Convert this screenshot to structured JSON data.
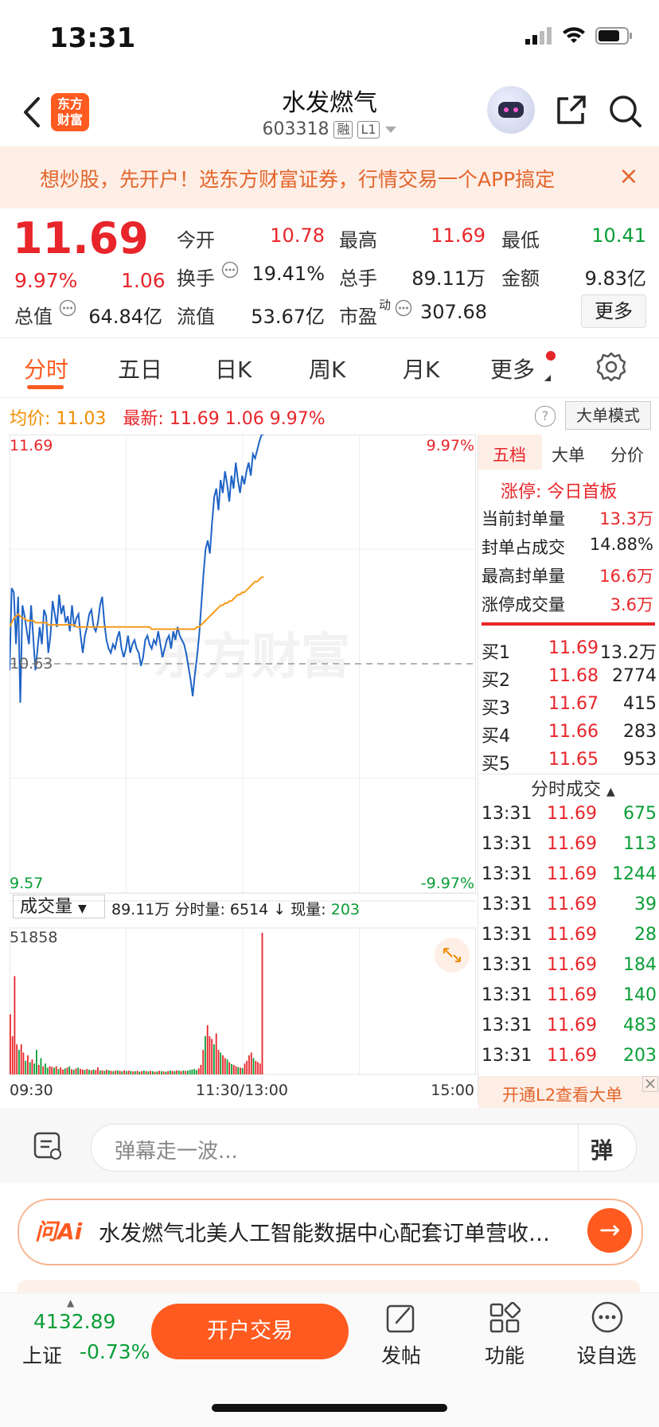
{
  "status_bar": {
    "time": "13:31"
  },
  "header": {
    "back_icon": "chevron-left-icon",
    "logo_line1": "东方",
    "logo_line2": "财富",
    "stock_name": "水发燃气",
    "stock_code": "603318",
    "tag_margin": "融",
    "tag_level": "L1"
  },
  "banner": {
    "text": "想炒股，先开户！选东方财富证券，行情交易一个APP搞定",
    "close": "×"
  },
  "quote": {
    "price": "11.69",
    "change_pct": "9.97%",
    "change": "1.06",
    "fields": [
      {
        "label": "今开",
        "value": "10.78",
        "color": "red"
      },
      {
        "label": "最高",
        "value": "11.69",
        "color": "red"
      },
      {
        "label": "最低",
        "value": "10.41",
        "color": "green"
      },
      {
        "label": "换手",
        "value": "19.41%",
        "color": "black"
      },
      {
        "label": "总手",
        "value": "89.11万",
        "color": "black"
      },
      {
        "label": "金额",
        "value": "9.83亿",
        "color": "black"
      },
      {
        "label": "总值",
        "value": "64.84亿",
        "color": "black"
      },
      {
        "label": "流值",
        "value": "53.67亿",
        "color": "black"
      },
      {
        "label": "市盈",
        "value": "307.68",
        "color": "black"
      }
    ],
    "pe_superscript": "动",
    "more_label": "更多"
  },
  "tabs": [
    "分时",
    "五日",
    "日K",
    "周K",
    "月K",
    "更多"
  ],
  "info_row": {
    "avg_label": "均价:",
    "avg_value": "11.03",
    "latest_label": "最新:",
    "latest_price": "11.69",
    "latest_change": "1.06",
    "latest_pct": "9.97%",
    "help": "?",
    "big_order_mode": "大单模式"
  },
  "chart": {
    "price_top": "11.69",
    "price_mid": "10.63",
    "price_bottom": "9.57",
    "pct_top": "9.97%",
    "pct_bottom": "-9.97%",
    "watermark": "东方财富",
    "vol_max_label": "51858",
    "time_start": "09:30",
    "time_mid": "11:30/13:00",
    "time_end": "15:00"
  },
  "chart_data": {
    "type": "line",
    "xlabel": "",
    "ylabel": "",
    "ylim": [
      9.57,
      11.69
    ],
    "x_ticks": [
      "09:30",
      "11:30/13:00",
      "15:00"
    ],
    "prev_close": 10.63,
    "series": [
      {
        "values": [
          10.6,
          10.98,
          10.96,
          10.72,
          10.94,
          10.45,
          10.9,
          10.85,
          10.78,
          10.72,
          10.9,
          10.75,
          10.6,
          10.7,
          10.8,
          10.72,
          10.88,
          10.85,
          10.68,
          10.76,
          10.92,
          10.86,
          10.8,
          10.95,
          10.86,
          10.9,
          10.82,
          10.85,
          10.78,
          10.9,
          10.8,
          10.84,
          10.86,
          10.76,
          10.68,
          10.76,
          10.8,
          10.86,
          10.88,
          10.8,
          10.78,
          10.82,
          10.9,
          10.94,
          10.82,
          10.74,
          10.7,
          10.68,
          10.72,
          10.7,
          10.75,
          10.78,
          10.7,
          10.66,
          10.7,
          10.76,
          10.68,
          10.72,
          10.74,
          10.7,
          10.68,
          10.62,
          10.66,
          10.74,
          10.76,
          10.72,
          10.7,
          10.74,
          10.72,
          10.78,
          10.72,
          10.66,
          10.7,
          10.74,
          10.76,
          10.7,
          10.78,
          10.74,
          10.8,
          10.76,
          10.74,
          10.72,
          10.68,
          10.62,
          10.56,
          10.48,
          10.58,
          10.66,
          10.76,
          10.9,
          11.04,
          11.16,
          11.2,
          11.14,
          11.28,
          11.4,
          11.44,
          11.34,
          11.48,
          11.42,
          11.52,
          11.46,
          11.38,
          11.5,
          11.44,
          11.56,
          11.48,
          11.42,
          11.5,
          11.46,
          11.52,
          11.56,
          11.5,
          11.6,
          11.58,
          11.62,
          11.66,
          11.69,
          11.69
        ]
      },
      {
        "values": [
          10.8,
          10.82,
          10.84,
          10.85,
          10.86,
          10.85,
          10.84,
          10.84,
          10.83,
          10.83,
          10.83,
          10.83,
          10.82,
          10.82,
          10.82,
          10.82,
          10.82,
          10.82,
          10.81,
          10.81,
          10.81,
          10.81,
          10.81,
          10.81,
          10.81,
          10.81,
          10.81,
          10.81,
          10.81,
          10.81,
          10.81,
          10.8,
          10.8,
          10.8,
          10.8,
          10.8,
          10.8,
          10.8,
          10.8,
          10.8,
          10.8,
          10.8,
          10.8,
          10.8,
          10.8,
          10.8,
          10.8,
          10.8,
          10.8,
          10.8,
          10.8,
          10.8,
          10.8,
          10.8,
          10.8,
          10.8,
          10.8,
          10.8,
          10.8,
          10.8,
          10.8,
          10.8,
          10.8,
          10.8,
          10.8,
          10.8,
          10.79,
          10.79,
          10.79,
          10.79,
          10.79,
          10.79,
          10.79,
          10.79,
          10.79,
          10.79,
          10.79,
          10.79,
          10.79,
          10.79,
          10.79,
          10.79,
          10.79,
          10.79,
          10.79,
          10.79,
          10.79,
          10.8,
          10.8,
          10.81,
          10.82,
          10.83,
          10.84,
          10.85,
          10.86,
          10.87,
          10.88,
          10.89,
          10.9,
          10.9,
          10.91,
          10.91,
          10.92,
          10.92,
          10.93,
          10.94,
          10.95,
          10.95,
          10.96,
          10.96,
          10.97,
          10.98,
          10.99,
          11.0,
          11.01,
          11.01,
          11.02,
          11.03,
          11.03
        ]
      }
    ],
    "volume": {
      "ymax": 51858,
      "values": [
        22000,
        14000,
        36000,
        11000,
        9000,
        11000,
        8000,
        5000,
        7000,
        4500,
        5500,
        4000,
        9000,
        3500,
        6000,
        3000,
        4000,
        2500,
        3000,
        2800,
        2500,
        3000,
        2000,
        2600,
        1800,
        2200,
        2500,
        3000,
        1900,
        1700,
        2200,
        2500,
        2000,
        1800,
        1600,
        2000,
        1700,
        1500,
        1800,
        1600,
        2600,
        1400,
        1500,
        1300,
        1700,
        1500,
        1300,
        1200,
        1400,
        1500,
        1300,
        1100,
        1500,
        1200,
        1400,
        1300,
        1100,
        1200,
        1300,
        1000,
        1200,
        1400,
        1200,
        1100,
        1300,
        1200,
        1000,
        1100,
        1300,
        1200,
        1100,
        1000,
        1200,
        1400,
        1300,
        1200,
        1500,
        1400,
        1200,
        1500,
        1300,
        1400,
        1600,
        1800,
        2000,
        1600,
        2200,
        3500,
        9000,
        14000,
        18000,
        14000,
        13000,
        11000,
        15000,
        9000,
        8000,
        7000,
        6000,
        5500,
        4500,
        3800,
        3500,
        3000,
        2700,
        2500,
        2300,
        4000,
        5000,
        7000,
        8000,
        6000,
        5000,
        4500,
        4000,
        51858
      ],
      "colors": [
        "red",
        "red",
        "red",
        "red",
        "green",
        "red",
        "red",
        "green",
        "red",
        "green",
        "red",
        "green",
        "green",
        "red",
        "green",
        "red",
        "green",
        "green",
        "red",
        "red",
        "green",
        "red",
        "green",
        "red",
        "red",
        "green",
        "red",
        "green",
        "red",
        "green",
        "red",
        "green",
        "red",
        "red",
        "green",
        "red",
        "green",
        "red",
        "green",
        "red",
        "red",
        "green",
        "red",
        "green",
        "red",
        "green",
        "red",
        "green",
        "red",
        "green",
        "red",
        "green",
        "red",
        "green",
        "red",
        "green",
        "red",
        "green",
        "red",
        "green",
        "red",
        "green",
        "red",
        "green",
        "red",
        "green",
        "red",
        "green",
        "red",
        "green",
        "red",
        "green",
        "red",
        "green",
        "red",
        "green",
        "red",
        "green",
        "red",
        "green",
        "red",
        "green",
        "green",
        "green",
        "green",
        "green",
        "red",
        "red",
        "red",
        "green",
        "red",
        "red",
        "red",
        "green",
        "red",
        "red",
        "green",
        "red",
        "red",
        "green",
        "red",
        "green",
        "red",
        "red",
        "green",
        "red",
        "green",
        "red",
        "red",
        "red",
        "red",
        "green",
        "red",
        "red",
        "red",
        "red"
      ]
    },
    "colors": {
      "price_line": "#1f63c6",
      "avg_line": "#f59a1b",
      "up": "#e8252a",
      "down": "#0a9e37"
    }
  },
  "volume_header": {
    "select_label": "成交量",
    "total": "89.11万",
    "minute_label": "分时量:",
    "minute_value": "6514",
    "now_label": "现量:",
    "now_value": "203"
  },
  "right_panel": {
    "tabs": [
      "五档",
      "大单",
      "分价"
    ],
    "limit_up_label": "涨停:",
    "limit_up_value": "今日首板",
    "stats": [
      {
        "label": "当前封单量",
        "value": "13.3万"
      },
      {
        "label": "封单占成交",
        "value": "14.88%"
      },
      {
        "label": "最高封单量",
        "value": "16.6万"
      },
      {
        "label": "涨停成交量",
        "value": "3.6万"
      }
    ],
    "bids": [
      {
        "label": "买1",
        "price": "11.69",
        "volume": "13.2万"
      },
      {
        "label": "买2",
        "price": "11.68",
        "volume": "2774"
      },
      {
        "label": "买3",
        "price": "11.67",
        "volume": "415"
      },
      {
        "label": "买4",
        "price": "11.66",
        "volume": "283"
      },
      {
        "label": "买5",
        "price": "11.65",
        "volume": "953"
      }
    ],
    "trades_header": "分时成交",
    "trades": [
      {
        "time": "13:31",
        "price": "11.69",
        "volume": "675"
      },
      {
        "time": "13:31",
        "price": "11.69",
        "volume": "113"
      },
      {
        "time": "13:31",
        "price": "11.69",
        "volume": "1244"
      },
      {
        "time": "13:31",
        "price": "11.69",
        "volume": "39"
      },
      {
        "time": "13:31",
        "price": "11.69",
        "volume": "28"
      },
      {
        "time": "13:31",
        "price": "11.69",
        "volume": "184"
      },
      {
        "time": "13:31",
        "price": "11.69",
        "volume": "140"
      },
      {
        "time": "13:31",
        "price": "11.69",
        "volume": "483"
      },
      {
        "time": "13:31",
        "price": "11.69",
        "volume": "203"
      }
    ],
    "l2_promo": "开通L2查看大单"
  },
  "comment_bar": {
    "placeholder": "弹幕走一波...",
    "danmu_btn": "弹"
  },
  "ai_bar": {
    "logo": "问Ai",
    "text": "水发燃气北美人工智能数据中心配套订单营收…"
  },
  "bottom_bar": {
    "index_value": "4132.89",
    "index_name": "上证",
    "index_pct": "-0.73%",
    "trade_btn": "开户交易",
    "post_label": "发帖",
    "func_label": "功能",
    "watch_label": "设自选"
  }
}
